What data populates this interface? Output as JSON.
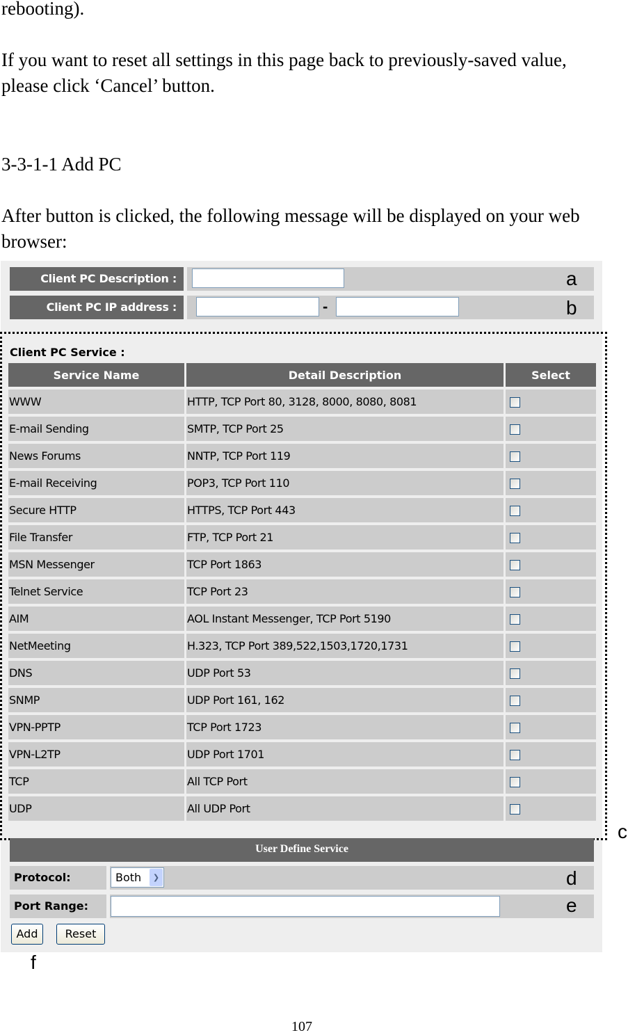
{
  "document": {
    "paragraphs": [
      "rebooting).",
      "If you want to reset all settings in this page back to previously-saved value, please click ‘Cancel’ button.",
      "3-3-1-1 Add PC",
      "After button is clicked, the following message will be displayed on your web browser:"
    ],
    "page_number": "107"
  },
  "form": {
    "description_label": "Client PC Description :",
    "description_value": "",
    "ip_label": "Client PC IP address :",
    "ip_start_value": "",
    "ip_separator": "-",
    "ip_end_value": "",
    "service_section_title": "Client PC Service :",
    "service_table": {
      "headers": [
        "Service Name",
        "Detail Description",
        "Select"
      ],
      "rows": [
        {
          "name": "WWW",
          "detail": "HTTP, TCP Port 80, 3128, 8000, 8080, 8081",
          "checked": false
        },
        {
          "name": "E-mail Sending",
          "detail": "SMTP, TCP Port 25",
          "checked": false
        },
        {
          "name": "News Forums",
          "detail": "NNTP, TCP Port 119",
          "checked": false
        },
        {
          "name": "E-mail Receiving",
          "detail": "POP3, TCP Port 110",
          "checked": false
        },
        {
          "name": "Secure HTTP",
          "detail": "HTTPS, TCP Port 443",
          "checked": false
        },
        {
          "name": "File Transfer",
          "detail": "FTP, TCP Port 21",
          "checked": false
        },
        {
          "name": "MSN Messenger",
          "detail": "TCP Port 1863",
          "checked": false
        },
        {
          "name": "Telnet Service",
          "detail": "TCP Port 23",
          "checked": false
        },
        {
          "name": "AIM",
          "detail": "AOL Instant Messenger, TCP Port 5190",
          "checked": false
        },
        {
          "name": "NetMeeting",
          "detail": "H.323, TCP Port 389,522,1503,1720,1731",
          "checked": false
        },
        {
          "name": "DNS",
          "detail": "UDP Port 53",
          "checked": false
        },
        {
          "name": "SNMP",
          "detail": "UDP Port 161, 162",
          "checked": false
        },
        {
          "name": "VPN-PPTP",
          "detail": "TCP Port 1723",
          "checked": false
        },
        {
          "name": "VPN-L2TP",
          "detail": "UDP Port 1701",
          "checked": false
        },
        {
          "name": "TCP",
          "detail": "All TCP Port",
          "checked": false
        },
        {
          "name": "UDP",
          "detail": "All UDP Port",
          "checked": false
        }
      ]
    },
    "user_define_title": "User Define Service",
    "protocol_label": "Protocol:",
    "protocol_selected": "Both",
    "port_range_label": "Port Range:",
    "port_range_value": "",
    "add_label": "Add",
    "reset_label": "Reset"
  },
  "callouts": {
    "a": "a",
    "b": "b",
    "c": "c",
    "d": "d",
    "e": "e",
    "f": "f"
  }
}
